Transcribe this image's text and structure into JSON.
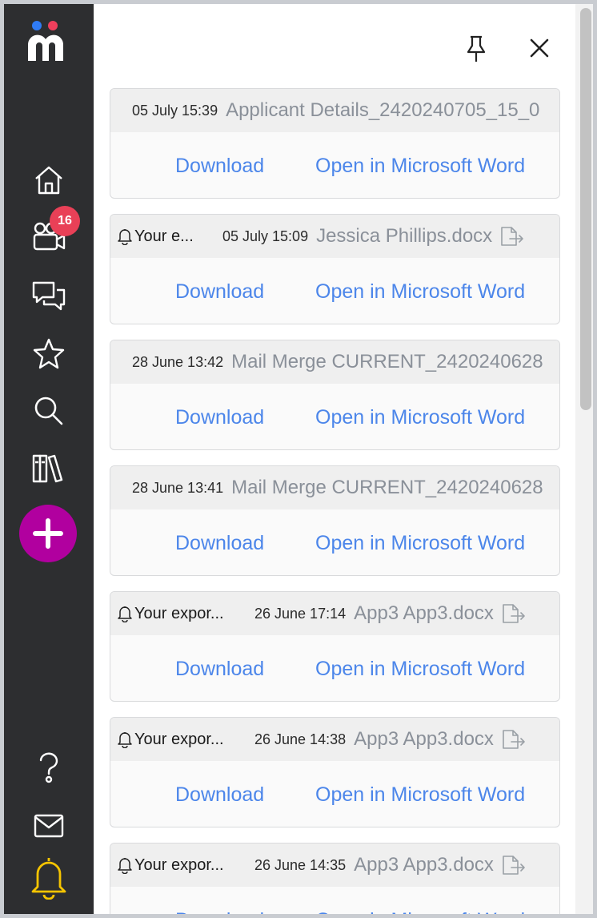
{
  "app": {
    "colors": {
      "sidebar_bg": "#2d2e30",
      "accent_link": "#4c86ea",
      "add_button": "#b1009f",
      "badge": "#e94057",
      "active_bell": "#f5c400",
      "logo_blue": "#2f7bf5",
      "logo_red": "#ef3f5c"
    }
  },
  "sidebar": {
    "items": [
      {
        "name": "home",
        "icon": "home-icon"
      },
      {
        "name": "videos",
        "icon": "video-camera-icon",
        "badge": "16"
      },
      {
        "name": "messages",
        "icon": "chat-bubbles-icon"
      },
      {
        "name": "favourites",
        "icon": "star-icon"
      },
      {
        "name": "search",
        "icon": "search-icon"
      },
      {
        "name": "library",
        "icon": "books-icon"
      },
      {
        "name": "add",
        "icon": "plus-icon"
      },
      {
        "name": "help",
        "icon": "question-icon"
      },
      {
        "name": "mail",
        "icon": "envelope-icon"
      },
      {
        "name": "notifications",
        "icon": "bell-icon",
        "active": true
      }
    ]
  },
  "panel": {
    "pin_icon": "pin-icon",
    "close_icon": "close-icon",
    "download_label": "Download",
    "open_word_label": "Open in Microsoft Word",
    "notifications": [
      {
        "notice": "",
        "timestamp": "05 July 15:39",
        "filename": "Applicant Details_2420240705_15_0",
        "has_bell": false,
        "has_open_icon": false
      },
      {
        "notice": "Your e...",
        "timestamp": "05 July 15:09",
        "filename": "Jessica Phillips.docx",
        "has_bell": true,
        "has_open_icon": true
      },
      {
        "notice": "",
        "timestamp": "28 June 13:42",
        "filename": "Mail Merge CURRENT_2420240628",
        "has_bell": false,
        "has_open_icon": false
      },
      {
        "notice": "",
        "timestamp": "28 June 13:41",
        "filename": "Mail Merge CURRENT_2420240628",
        "has_bell": false,
        "has_open_icon": false
      },
      {
        "notice": "Your expor...",
        "timestamp": "26 June 17:14",
        "filename": "App3 App3.docx",
        "has_bell": true,
        "has_open_icon": true
      },
      {
        "notice": "Your expor...",
        "timestamp": "26 June 14:38",
        "filename": "App3 App3.docx",
        "has_bell": true,
        "has_open_icon": true
      },
      {
        "notice": "Your expor...",
        "timestamp": "26 June 14:35",
        "filename": "App3 App3.docx",
        "has_bell": true,
        "has_open_icon": true
      }
    ]
  }
}
